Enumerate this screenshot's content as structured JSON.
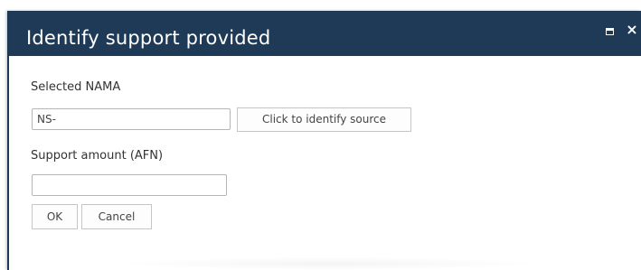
{
  "dialog": {
    "title": "Identify support provided",
    "maximize_icon": "maximize-icon",
    "close_icon": "close-icon",
    "close_glyph": "×"
  },
  "form": {
    "nama_label": "Selected NAMA",
    "nama_value": "NS-",
    "identify_button": "Click to identify source",
    "amount_label": "Support amount (AFN)",
    "amount_value": "",
    "ok_button": "OK",
    "cancel_button": "Cancel"
  },
  "colors": {
    "titlebar": "#1e3a57",
    "title_text": "#ffffff",
    "label_text": "#333333",
    "field_border": "#b5b5b5",
    "button_border": "#c6c6c6"
  }
}
